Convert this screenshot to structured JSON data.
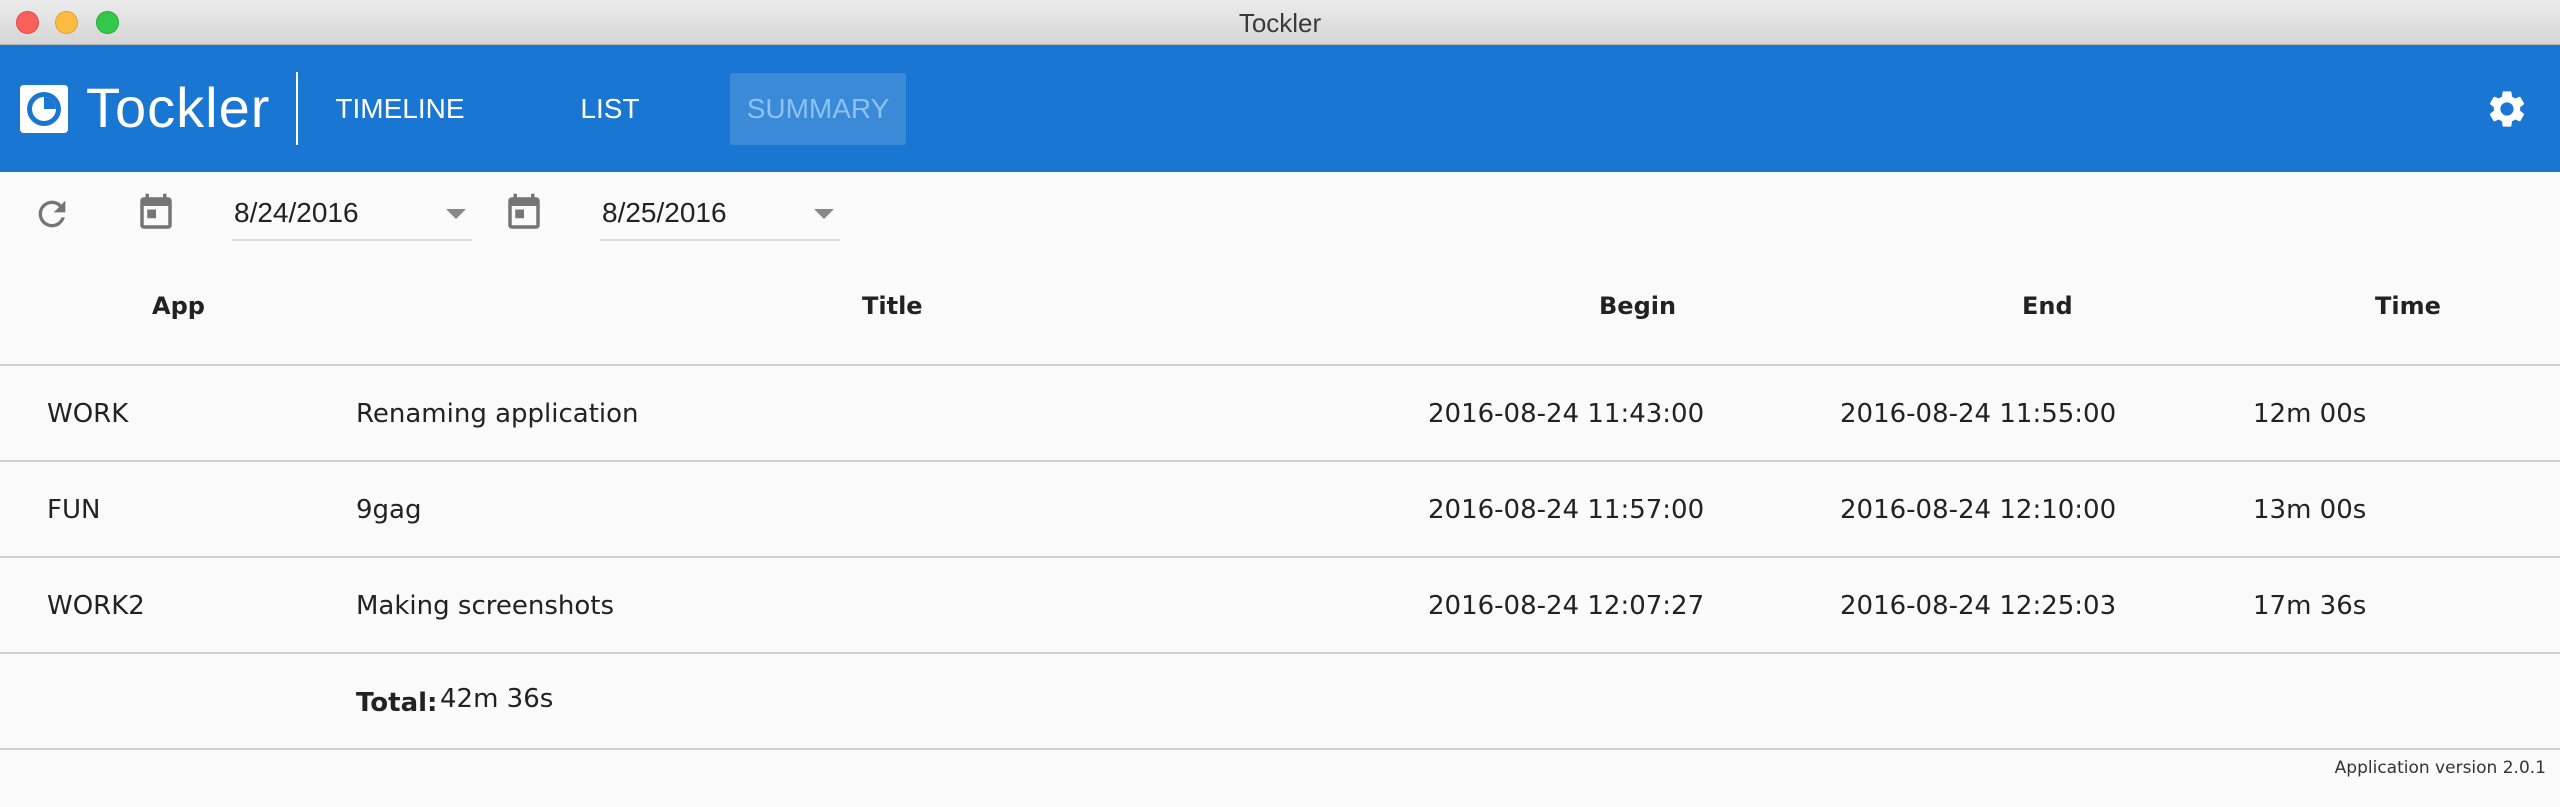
{
  "window": {
    "title": "Tockler"
  },
  "appbar": {
    "brand": "Tockler",
    "nav": [
      {
        "label": "TIMELINE"
      },
      {
        "label": "LIST"
      },
      {
        "label": "SUMMARY",
        "active": true
      }
    ],
    "color": "#1976d2"
  },
  "toolbar": {
    "from_date": "8/24/2016",
    "to_date": "8/25/2016"
  },
  "table": {
    "headers": {
      "app": "App",
      "title": "Title",
      "begin": "Begin",
      "end": "End",
      "time": "Time"
    },
    "rows": [
      {
        "app": "WORK",
        "title": "Renaming application",
        "begin": "2016-08-24 11:43:00",
        "end": "2016-08-24 11:55:00",
        "time": "12m 00s"
      },
      {
        "app": "FUN",
        "title": "9gag",
        "begin": "2016-08-24 11:57:00",
        "end": "2016-08-24 12:10:00",
        "time": "13m 00s"
      },
      {
        "app": "WORK2",
        "title": "Making screenshots",
        "begin": "2016-08-24 12:07:27",
        "end": "2016-08-24 12:25:03",
        "time": "17m 36s"
      }
    ],
    "total_label": "Total:",
    "total_value": "42m 36s"
  },
  "footer": {
    "version": "Application version 2.0.1"
  },
  "icons": [
    "logo-icon",
    "gear-icon",
    "refresh-icon",
    "calendar-icon",
    "chevron-down-icon"
  ]
}
